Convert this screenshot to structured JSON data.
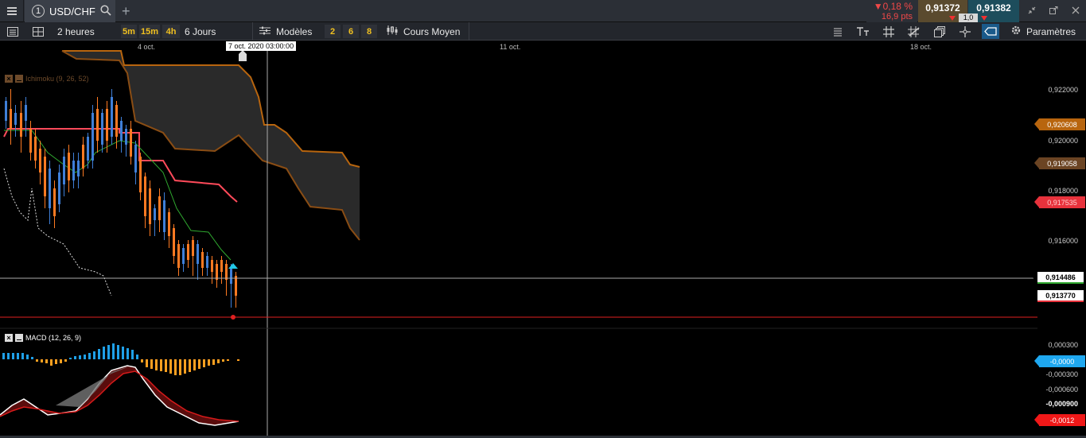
{
  "header": {
    "tab_number": "1",
    "symbol": "USD/CHF",
    "change_pct": "▼0,18 %",
    "change_pts": "16,9 pts",
    "bid": "0,91372",
    "ask": "0,91382",
    "spread": "1,0"
  },
  "toolbar": {
    "timeframe": "2 heures",
    "tf_buttons": [
      "5m",
      "15m",
      "4h"
    ],
    "range": "6 Jours",
    "models_label": "Modèles",
    "model_buttons": [
      "2",
      "6",
      "8"
    ],
    "price_type": "Cours Moyen",
    "settings_label": "Paramètres"
  },
  "chart": {
    "date_labels": [
      "4 oct.",
      "11 oct.",
      "18 oct."
    ],
    "cursor_date": "7 oct. 2020 03:00:00",
    "price_axis": [
      "0,922000",
      "0,920000",
      "0,918000",
      "0,916000"
    ],
    "tags": {
      "span_a": "0,920608",
      "span_b": "0,919058",
      "kijun": "0,917535",
      "crosshair": "0,914486",
      "last": "0,913770"
    },
    "ichimoku_label": "Ichimoku (9, 26, 52)",
    "macd_label": "MACD (12, 26, 9)",
    "macd_axis": [
      "0,000300",
      "-0,000300",
      "-0,000600",
      "-0,000900"
    ],
    "macd_tags": {
      "hist": "-0,0000",
      "signal": "-0,0012"
    }
  },
  "colors": {
    "bull": "#3f7fd8",
    "bear": "#ff7a22",
    "kijun": "#ff4a5a",
    "tenkan": "#2fa82f",
    "cloud_edge": "#b8650e",
    "macd_pos": "#1fa0e8",
    "macd_neg": "#ffa020"
  }
}
